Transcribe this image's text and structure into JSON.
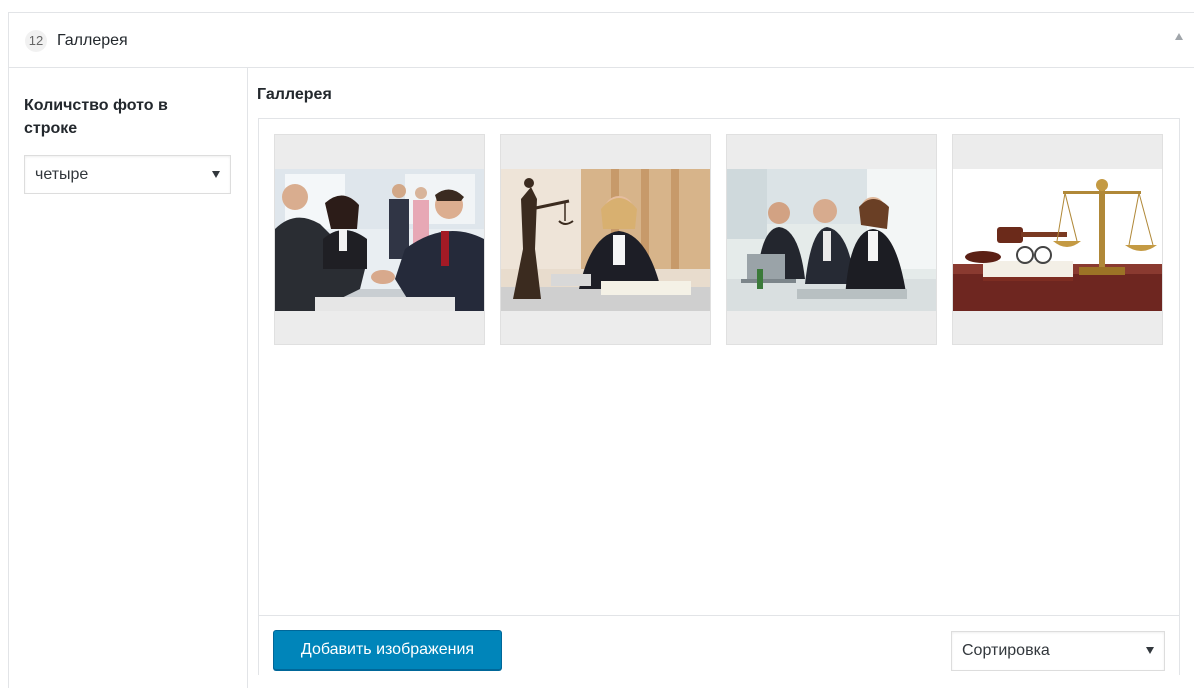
{
  "section": {
    "order_number": "12",
    "title": "Галлерея"
  },
  "sidebar": {
    "label": "Количство фото в строке",
    "select_value": "четыре"
  },
  "gallery": {
    "label": "Галлерея",
    "images": [
      {
        "alt": "handshake-business-meeting"
      },
      {
        "alt": "lawyer-with-themis-statue"
      },
      {
        "alt": "office-team-at-laptop"
      },
      {
        "alt": "scales-and-gavel"
      }
    ],
    "add_button": "Добавить изображения",
    "sort_select": "Сортировка"
  },
  "colors": {
    "primary_button": "#0085ba",
    "border": "#e2e4e7"
  }
}
